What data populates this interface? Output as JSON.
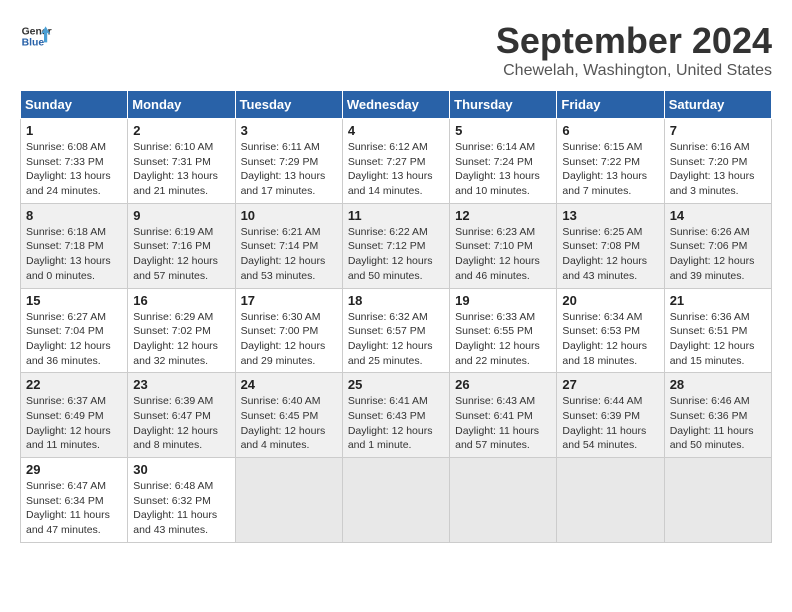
{
  "header": {
    "logo_line1": "General",
    "logo_line2": "Blue",
    "month_title": "September 2024",
    "location": "Chewelah, Washington, United States"
  },
  "weekdays": [
    "Sunday",
    "Monday",
    "Tuesday",
    "Wednesday",
    "Thursday",
    "Friday",
    "Saturday"
  ],
  "weeks": [
    [
      {
        "day": "1",
        "info": "Sunrise: 6:08 AM\nSunset: 7:33 PM\nDaylight: 13 hours\nand 24 minutes."
      },
      {
        "day": "2",
        "info": "Sunrise: 6:10 AM\nSunset: 7:31 PM\nDaylight: 13 hours\nand 21 minutes."
      },
      {
        "day": "3",
        "info": "Sunrise: 6:11 AM\nSunset: 7:29 PM\nDaylight: 13 hours\nand 17 minutes."
      },
      {
        "day": "4",
        "info": "Sunrise: 6:12 AM\nSunset: 7:27 PM\nDaylight: 13 hours\nand 14 minutes."
      },
      {
        "day": "5",
        "info": "Sunrise: 6:14 AM\nSunset: 7:24 PM\nDaylight: 13 hours\nand 10 minutes."
      },
      {
        "day": "6",
        "info": "Sunrise: 6:15 AM\nSunset: 7:22 PM\nDaylight: 13 hours\nand 7 minutes."
      },
      {
        "day": "7",
        "info": "Sunrise: 6:16 AM\nSunset: 7:20 PM\nDaylight: 13 hours\nand 3 minutes."
      }
    ],
    [
      {
        "day": "8",
        "info": "Sunrise: 6:18 AM\nSunset: 7:18 PM\nDaylight: 13 hours\nand 0 minutes."
      },
      {
        "day": "9",
        "info": "Sunrise: 6:19 AM\nSunset: 7:16 PM\nDaylight: 12 hours\nand 57 minutes."
      },
      {
        "day": "10",
        "info": "Sunrise: 6:21 AM\nSunset: 7:14 PM\nDaylight: 12 hours\nand 53 minutes."
      },
      {
        "day": "11",
        "info": "Sunrise: 6:22 AM\nSunset: 7:12 PM\nDaylight: 12 hours\nand 50 minutes."
      },
      {
        "day": "12",
        "info": "Sunrise: 6:23 AM\nSunset: 7:10 PM\nDaylight: 12 hours\nand 46 minutes."
      },
      {
        "day": "13",
        "info": "Sunrise: 6:25 AM\nSunset: 7:08 PM\nDaylight: 12 hours\nand 43 minutes."
      },
      {
        "day": "14",
        "info": "Sunrise: 6:26 AM\nSunset: 7:06 PM\nDaylight: 12 hours\nand 39 minutes."
      }
    ],
    [
      {
        "day": "15",
        "info": "Sunrise: 6:27 AM\nSunset: 7:04 PM\nDaylight: 12 hours\nand 36 minutes."
      },
      {
        "day": "16",
        "info": "Sunrise: 6:29 AM\nSunset: 7:02 PM\nDaylight: 12 hours\nand 32 minutes."
      },
      {
        "day": "17",
        "info": "Sunrise: 6:30 AM\nSunset: 7:00 PM\nDaylight: 12 hours\nand 29 minutes."
      },
      {
        "day": "18",
        "info": "Sunrise: 6:32 AM\nSunset: 6:57 PM\nDaylight: 12 hours\nand 25 minutes."
      },
      {
        "day": "19",
        "info": "Sunrise: 6:33 AM\nSunset: 6:55 PM\nDaylight: 12 hours\nand 22 minutes."
      },
      {
        "day": "20",
        "info": "Sunrise: 6:34 AM\nSunset: 6:53 PM\nDaylight: 12 hours\nand 18 minutes."
      },
      {
        "day": "21",
        "info": "Sunrise: 6:36 AM\nSunset: 6:51 PM\nDaylight: 12 hours\nand 15 minutes."
      }
    ],
    [
      {
        "day": "22",
        "info": "Sunrise: 6:37 AM\nSunset: 6:49 PM\nDaylight: 12 hours\nand 11 minutes."
      },
      {
        "day": "23",
        "info": "Sunrise: 6:39 AM\nSunset: 6:47 PM\nDaylight: 12 hours\nand 8 minutes."
      },
      {
        "day": "24",
        "info": "Sunrise: 6:40 AM\nSunset: 6:45 PM\nDaylight: 12 hours\nand 4 minutes."
      },
      {
        "day": "25",
        "info": "Sunrise: 6:41 AM\nSunset: 6:43 PM\nDaylight: 12 hours\nand 1 minute."
      },
      {
        "day": "26",
        "info": "Sunrise: 6:43 AM\nSunset: 6:41 PM\nDaylight: 11 hours\nand 57 minutes."
      },
      {
        "day": "27",
        "info": "Sunrise: 6:44 AM\nSunset: 6:39 PM\nDaylight: 11 hours\nand 54 minutes."
      },
      {
        "day": "28",
        "info": "Sunrise: 6:46 AM\nSunset: 6:36 PM\nDaylight: 11 hours\nand 50 minutes."
      }
    ],
    [
      {
        "day": "29",
        "info": "Sunrise: 6:47 AM\nSunset: 6:34 PM\nDaylight: 11 hours\nand 47 minutes."
      },
      {
        "day": "30",
        "info": "Sunrise: 6:48 AM\nSunset: 6:32 PM\nDaylight: 11 hours\nand 43 minutes."
      },
      {
        "day": "",
        "info": ""
      },
      {
        "day": "",
        "info": ""
      },
      {
        "day": "",
        "info": ""
      },
      {
        "day": "",
        "info": ""
      },
      {
        "day": "",
        "info": ""
      }
    ]
  ]
}
